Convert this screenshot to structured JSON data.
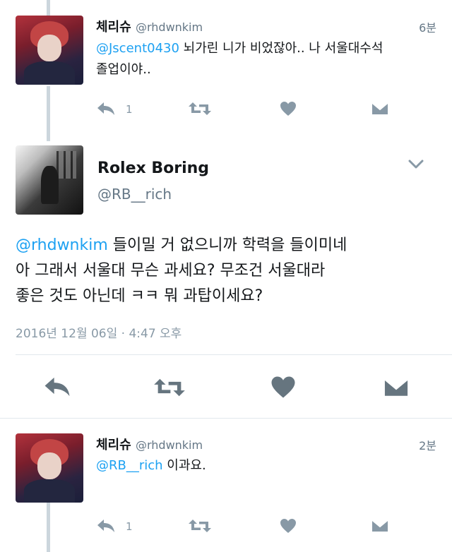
{
  "tweets": [
    {
      "display_name": "체리슈",
      "handle": "@rhdwnkim",
      "time": "6분",
      "mention": "@Jscent0430",
      "text_line1_rest": " 뇌가린 니가 비었잖아.. 나 서울대수석",
      "text_line2": "졸업이야..",
      "reply_count": "1"
    },
    {
      "display_name": "Rolex Boring",
      "handle": "@RB__rich",
      "mention": "@rhdwnkim",
      "text_line1_rest": " 들이밀 거 없으니까 학력을 들이미네",
      "text_line2": "아 그래서 서울대 무슨 과세요? 무조건 서울대라",
      "text_line3": "좋은 것도 아닌데 ㅋㅋ 뭐 과탑이세요?",
      "timestamp": "2016년 12월 06일 · 4:47 오후"
    },
    {
      "display_name": "체리슈",
      "handle": "@rhdwnkim",
      "time": "2분",
      "mention": "@RB__rich",
      "text_rest": " 이과요.",
      "reply_count": "1"
    }
  ],
  "icons": [
    "reply-icon",
    "retweet-icon",
    "like-icon",
    "direct-message-icon",
    "chevron-down-icon"
  ],
  "colors": {
    "link": "#1da1f2",
    "muted": "#657786",
    "icon": "#8899a6",
    "icon_main": "#66757f"
  }
}
